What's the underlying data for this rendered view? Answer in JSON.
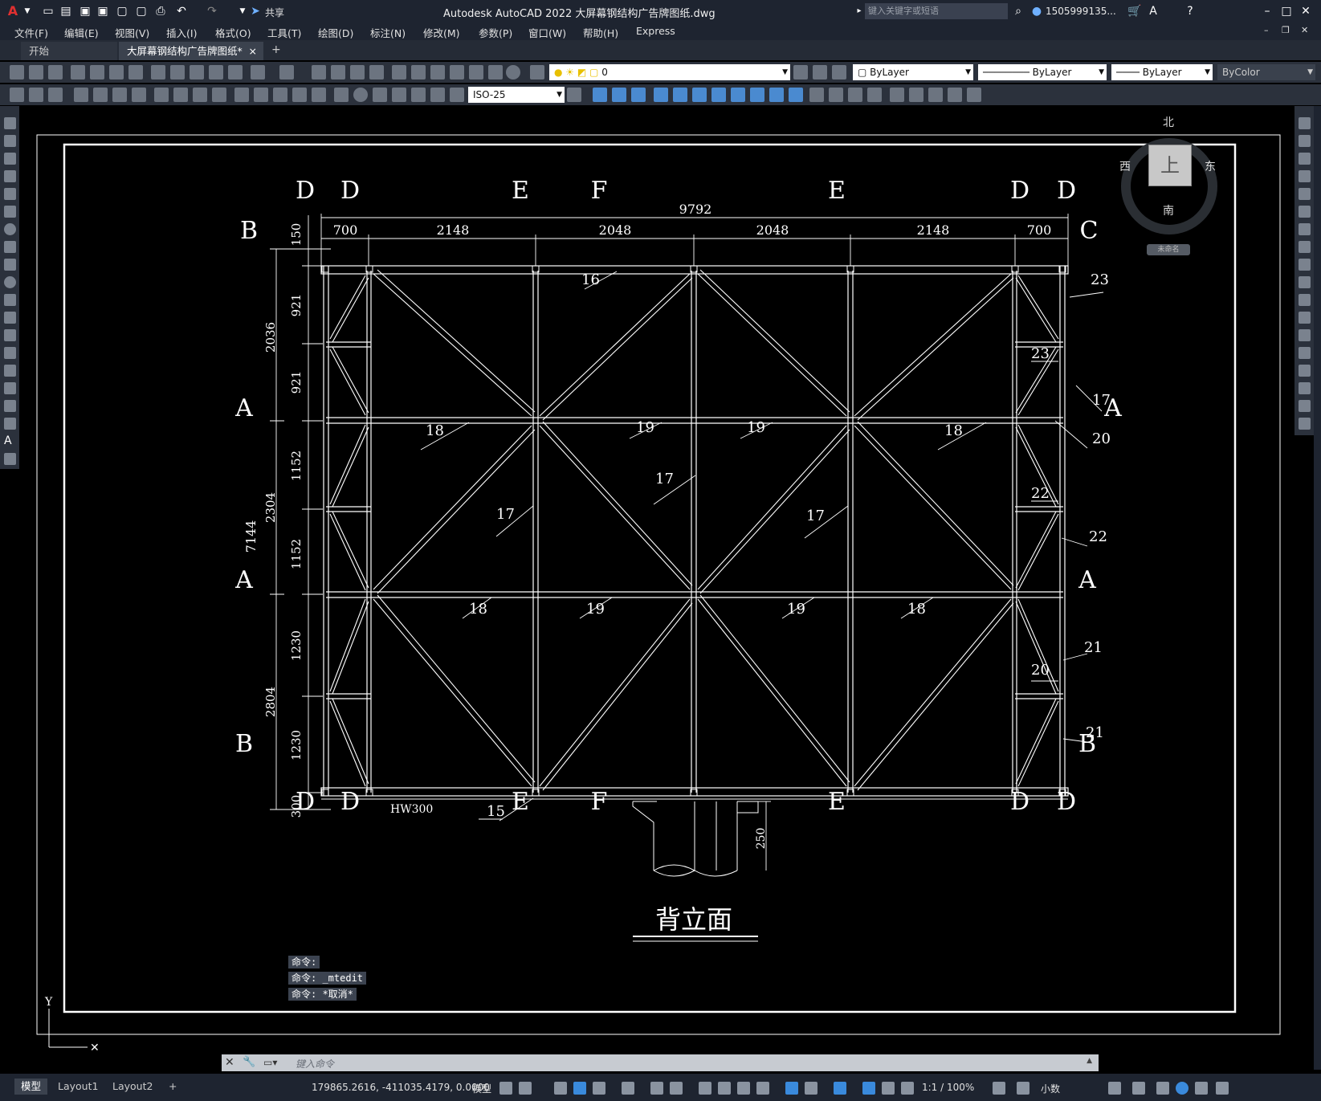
{
  "app": {
    "title": "Autodesk AutoCAD 2022    大屏幕钢结构广告牌图纸.dwg",
    "share_label": "共享",
    "search_placeholder": "键入关键字或短语",
    "user": "1505999135...",
    "colors": {
      "titlebar": "#1e2430",
      "toolbar": "#2b313c",
      "canvas": "#000000",
      "drawing": "#ffffff"
    }
  },
  "menu": [
    "文件(F)",
    "编辑(E)",
    "视图(V)",
    "插入(I)",
    "格式(O)",
    "工具(T)",
    "绘图(D)",
    "标注(N)",
    "修改(M)",
    "参数(P)",
    "窗口(W)",
    "帮助(H)",
    "Express"
  ],
  "tabs": {
    "start": "开始",
    "active": "大屏幕钢结构广告牌图纸*",
    "close": "×",
    "add": "+"
  },
  "ribbon": {
    "layer": "0",
    "color": "ByLayer",
    "linetype": "ByLayer",
    "lineweight": "ByLayer",
    "plotstyle": "ByColor",
    "dimstyle": "ISO-25"
  },
  "viewcube": {
    "north": "北",
    "south": "南",
    "east": "东",
    "west": "西",
    "top": "上",
    "ucs": "未命名"
  },
  "drawing": {
    "title": "背立面",
    "total_width": "9792",
    "bay_dims": [
      "700",
      "2148",
      "2048",
      "2048",
      "2148",
      "700"
    ],
    "left_dims_inner": [
      "150",
      "921",
      "921",
      "1152",
      "1152",
      "1230",
      "1230",
      "300"
    ],
    "left_dims_mid": [
      "2036",
      "2304",
      "2804"
    ],
    "left_dim_total": "7144",
    "bottom_dim": "250",
    "beam_label": "HW300",
    "section_top": [
      "D",
      "D",
      "E",
      "F",
      "E",
      "D",
      "D"
    ],
    "section_bottom": [
      "D",
      "D",
      "E",
      "F",
      "E",
      "D",
      "D"
    ],
    "side_marks_left": [
      "B",
      "A",
      "A",
      "B"
    ],
    "side_marks_right": [
      "C",
      "A",
      "A",
      "B"
    ],
    "callouts": [
      "16",
      "23",
      "23",
      "17",
      "18",
      "19",
      "19",
      "18",
      "20",
      "17",
      "17",
      "17",
      "22",
      "22",
      "18",
      "19",
      "19",
      "18",
      "21",
      "20",
      "21",
      "15"
    ]
  },
  "command": {
    "history": [
      "命令:",
      "命令: _mtedit",
      "命令: *取消*"
    ],
    "placeholder": "键入命令"
  },
  "layouts": [
    "模型",
    "Layout1",
    "Layout2",
    "+"
  ],
  "status": {
    "coords": "179865.2616, -411035.4179, 0.0000",
    "model": "模型",
    "scale": "1:1 / 100%",
    "units": "小数"
  }
}
